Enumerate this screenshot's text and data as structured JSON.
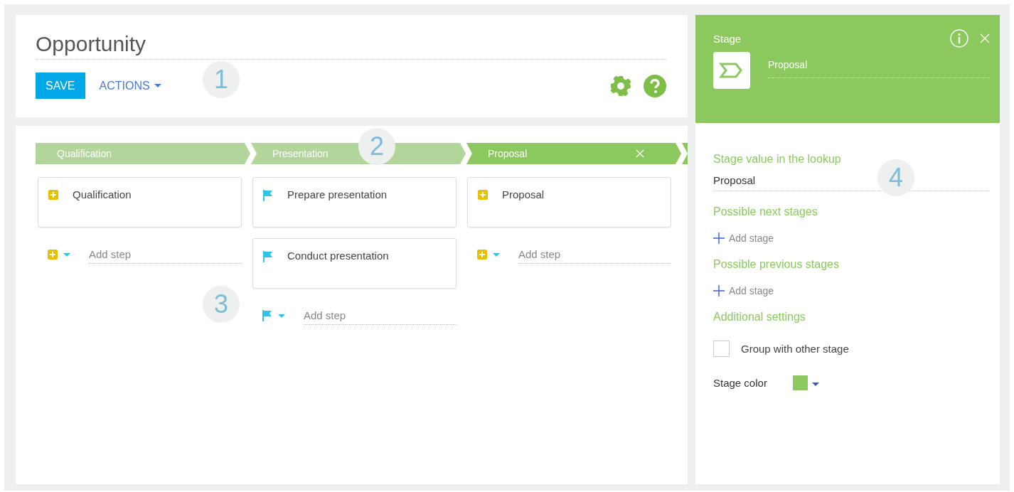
{
  "page": {
    "title": "Opportunity"
  },
  "toolbar": {
    "save": "SAVE",
    "actions": "ACTIONS"
  },
  "stages": [
    {
      "name": "Qualification",
      "selected": false,
      "steps": [
        {
          "kind": "task",
          "title": "Qualification"
        }
      ],
      "add_step": {
        "kind": "task",
        "placeholder": "Add step"
      }
    },
    {
      "name": "Presentation",
      "selected": false,
      "steps": [
        {
          "kind": "flag",
          "title": "Prepare presentation"
        },
        {
          "kind": "flag",
          "title": "Conduct presentation"
        }
      ],
      "add_step": {
        "kind": "flag",
        "placeholder": "Add step"
      }
    },
    {
      "name": "Proposal",
      "selected": true,
      "steps": [
        {
          "kind": "task",
          "title": "Proposal"
        }
      ],
      "add_step": {
        "kind": "task",
        "placeholder": "Add step"
      }
    }
  ],
  "stage_panel": {
    "title": "Stage",
    "name": "Proposal",
    "lookup_label": "Stage value in the lookup",
    "lookup_value": "Proposal",
    "next_label": "Possible next stages",
    "next_add": "Add stage",
    "prev_label": "Possible previous stages",
    "prev_add": "Add stage",
    "additional_label": "Additional settings",
    "group_checkbox": {
      "label": "Group with other stage",
      "checked": false
    },
    "color_label": "Stage color",
    "color": "#8bc95e"
  },
  "callouts": [
    "1",
    "2",
    "3",
    "4"
  ]
}
